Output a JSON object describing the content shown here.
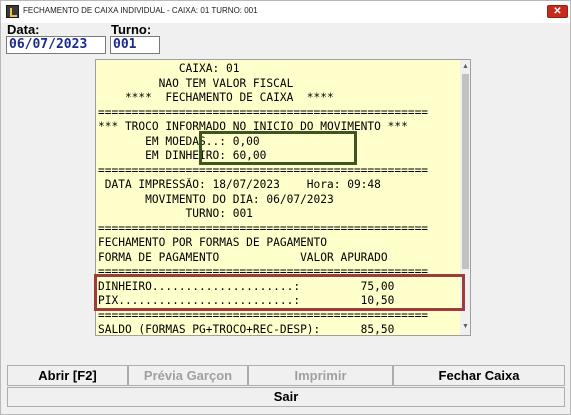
{
  "window": {
    "title": "FECHAMENTO DE CAIXA INDIVIDUAL - CAIXA: 01 TURNO: 001",
    "close_glyph": "✕"
  },
  "header": {
    "data_label": "Data:",
    "data_value": "06/07/2023",
    "turno_label": "Turno:",
    "turno_value": "001"
  },
  "receipt": {
    "lines": [
      "            CAIXA: 01",
      "         NAO TEM VALOR FISCAL",
      "    ****  FECHAMENTO DE CAIXA  ****",
      "=================================================",
      "*** TROCO INFORMADO NO INICIO DO MOVIMENTO ***",
      "       EM MOEDAS..: 0,00",
      "       EM DINHEIRO: 60,00",
      "=================================================",
      " DATA IMPRESSÃO: 18/07/2023    Hora: 09:48",
      "       MOVIMENTO DO DIA: 06/07/2023",
      "             TURNO: 001",
      "=================================================",
      "FECHAMENTO POR FORMAS DE PAGAMENTO",
      "FORMA DE PAGAMENTO            VALOR APURADO",
      "=================================================",
      "DINHEIRO.....................:         75,00",
      "PIX..........................:         10,50",
      "=================================================",
      "SALDO (FORMAS PG+TROCO+REC-DESP):      85,50"
    ],
    "scroll_up": "▲",
    "scroll_down": "▼"
  },
  "buttons": {
    "abrir": "Abrir [F2]",
    "previa": "Prévia Garçon",
    "imprimir": "Imprimir",
    "fechar": "Fechar Caixa",
    "sair": "Sair"
  },
  "colors": {
    "receipt_bg": "#ffffcc",
    "highlight_green": "#3e5522",
    "highlight_red": "#a03b3b",
    "field_text": "#1a2a8f"
  }
}
